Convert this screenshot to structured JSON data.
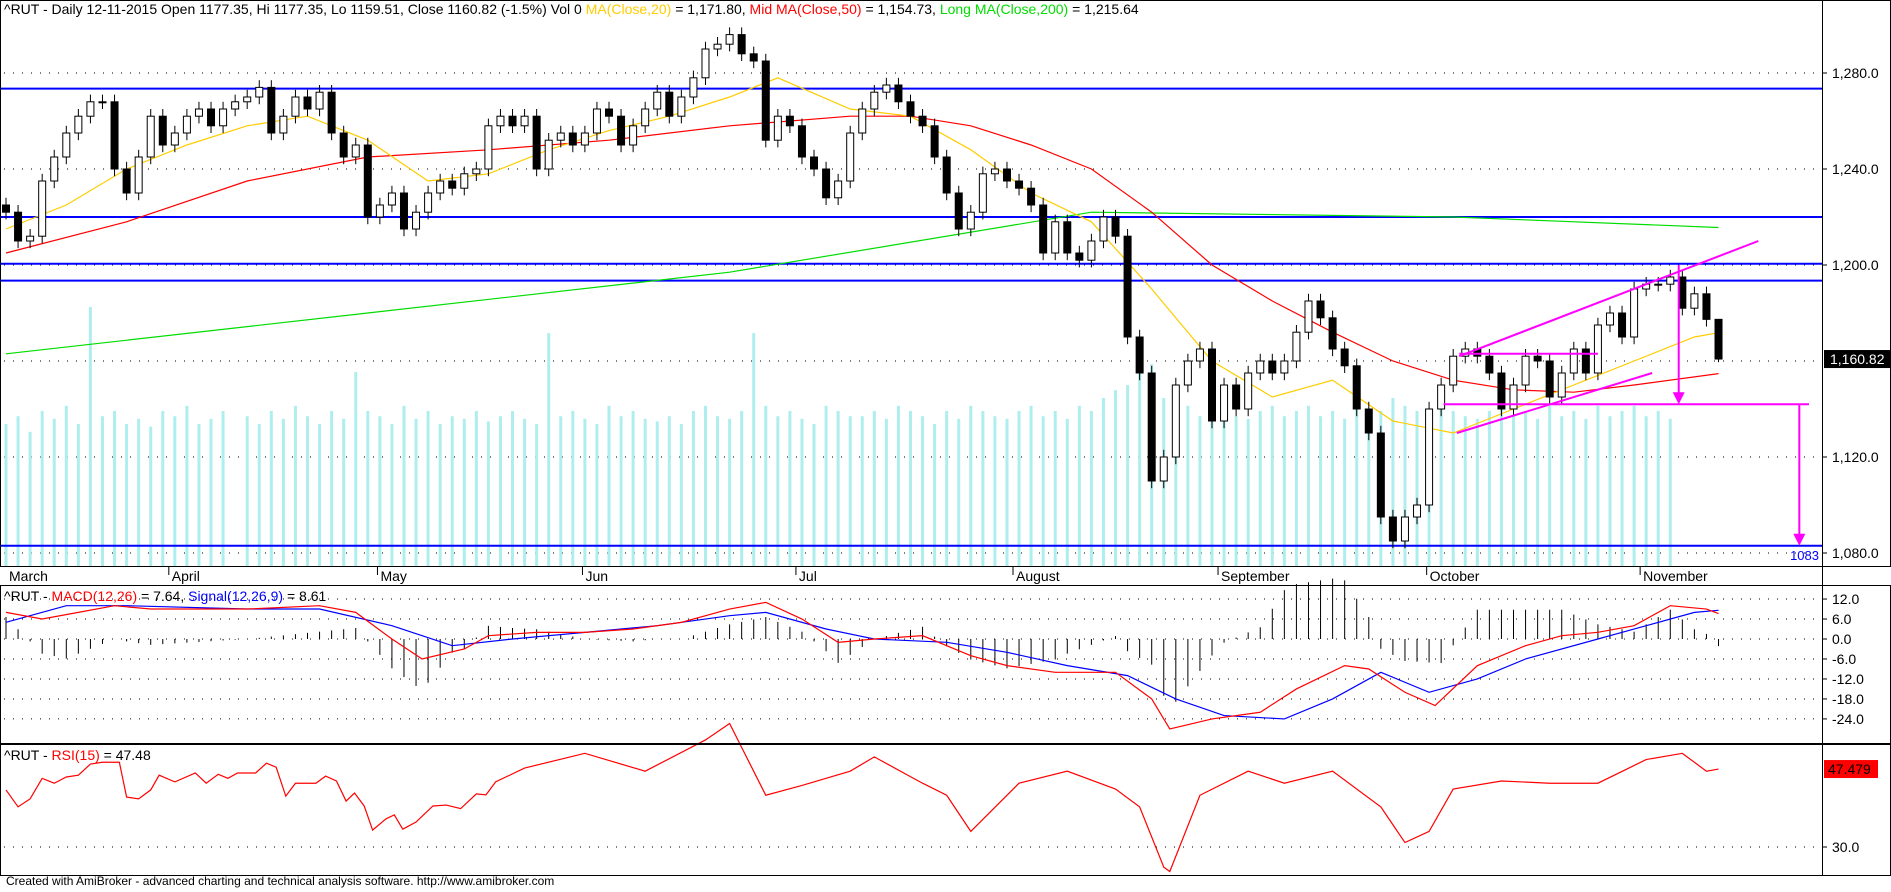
{
  "header": {
    "symbol_prefix": "^RUT - Daily 12-11-2015 Open 1177.35, Hi 1177.35, Lo 1159.51, Close 1160.82 (-1.5%) Vol 0 ",
    "ma20_label": "MA(Close,20)",
    "ma20_value": " = 1,171.80, ",
    "ma50_label": "Mid MA(Close,50)",
    "ma50_value": " = 1,154.73, ",
    "ma200_label": "Long MA(Close,200)",
    "ma200_value": " = 1,215.64"
  },
  "macd_header": {
    "prefix": "^RUT - ",
    "macd_label": "MACD(12,26)",
    "macd_value": " = 7.64, ",
    "signal_label": "Signal(12,26,9)",
    "signal_value": " = 8.61"
  },
  "rsi_header": {
    "prefix": "^RUT - ",
    "rsi_label": "RSI(15)",
    "rsi_value": " = 47.48"
  },
  "footer": "Created with AmiBroker - advanced charting and technical analysis software. http://www.amibroker.com",
  "colors": {
    "ma20": "#ffcc00",
    "ma50": "#ff0000",
    "ma200": "#00dd00",
    "macd": "#ff0000",
    "signal": "#0000ff",
    "rsi": "#ff0000",
    "level": "#0000ff",
    "annot": "#ff00ff",
    "volume": "#afeeee"
  },
  "chart_data": [
    {
      "type": "candlestick",
      "title": "^RUT - Daily",
      "ylim": [
        1075,
        1305
      ],
      "y_ticks": [
        "1,280.0",
        "1,240.0",
        "1,200.0",
        "1,120.0",
        "1,080.0"
      ],
      "y_tick_values": [
        1280,
        1240,
        1200,
        1120,
        1080
      ],
      "last_price_label": "1,160.82",
      "last_price": 1160.82,
      "months": [
        "March",
        "April",
        "May",
        "Jun",
        "Jul",
        "August",
        "September",
        "October",
        "November"
      ],
      "month_start_index": [
        0,
        13.5,
        30.8,
        47.8,
        65.5,
        83.5,
        100.5,
        117.8,
        135.5
      ],
      "close": [
        1222,
        1210,
        1212,
        1235,
        1245,
        1255,
        1262,
        1268,
        1268,
        1240,
        1230,
        1245,
        1262,
        1250,
        1255,
        1262,
        1265,
        1258,
        1265,
        1268,
        1270,
        1274,
        1255,
        1262,
        1270,
        1265,
        1272,
        1255,
        1245,
        1250,
        1220,
        1225,
        1230,
        1215,
        1222,
        1230,
        1235,
        1232,
        1238,
        1240,
        1258,
        1262,
        1258,
        1262,
        1240,
        1252,
        1255,
        1250,
        1255,
        1265,
        1262,
        1250,
        1258,
        1265,
        1272,
        1262,
        1270,
        1278,
        1290,
        1292,
        1296,
        1288,
        1285,
        1252,
        1262,
        1258,
        1245,
        1240,
        1228,
        1235,
        1255,
        1265,
        1272,
        1275,
        1268,
        1262,
        1258,
        1245,
        1230,
        1215,
        1222,
        1238,
        1240,
        1235,
        1232,
        1225,
        1205,
        1218,
        1205,
        1202,
        1210,
        1220,
        1212,
        1170,
        1155,
        1110,
        1120,
        1150,
        1160,
        1165,
        1135,
        1150,
        1140,
        1155,
        1160,
        1155,
        1160,
        1172,
        1185,
        1178,
        1165,
        1158,
        1140,
        1130,
        1095,
        1085,
        1095,
        1100,
        1140,
        1150,
        1162,
        1165,
        1162,
        1155,
        1140,
        1150,
        1162,
        1160,
        1145,
        1155,
        1165,
        1155,
        1175,
        1180,
        1170,
        1190,
        1192,
        1192,
        1195,
        1182,
        1188,
        1177.35,
        1160.82
      ],
      "first_open": 1225,
      "last_bar": {
        "open": 1177.35,
        "high": 1177.35,
        "low": 1159.51,
        "close": 1160.82
      },
      "volume": [
        55,
        58,
        52,
        60,
        57,
        62,
        55,
        100,
        58,
        60,
        55,
        57,
        54,
        60,
        58,
        62,
        55,
        57,
        60,
        0,
        58,
        55,
        60,
        57,
        62,
        58,
        55,
        60,
        57,
        75,
        60,
        58,
        55,
        62,
        57,
        60,
        55,
        58,
        57,
        60,
        56,
        58,
        60,
        57,
        55,
        90,
        58,
        60,
        57,
        55,
        62,
        58,
        60,
        57,
        56,
        58,
        55,
        60,
        62,
        58,
        57,
        60,
        90,
        62,
        58,
        60,
        57,
        55,
        62,
        60,
        58,
        58,
        60,
        57,
        62,
        60,
        58,
        55,
        60,
        57,
        62,
        60,
        58,
        57,
        60,
        62,
        58,
        60,
        57,
        62,
        60,
        65,
        68,
        70,
        85,
        78,
        65,
        60,
        62,
        58,
        60,
        62,
        58,
        57,
        60,
        62,
        58,
        60,
        62,
        58,
        60,
        57,
        62,
        58,
        60,
        65,
        62,
        60,
        58,
        62,
        60,
        58,
        57,
        60,
        62,
        58,
        60,
        57,
        62,
        58,
        60,
        57,
        62,
        58,
        60,
        62,
        58,
        60,
        57
      ],
      "ma20": [
        [
          0,
          1215
        ],
        [
          5,
          1225
        ],
        [
          10,
          1240
        ],
        [
          15,
          1250
        ],
        [
          20,
          1258
        ],
        [
          25,
          1262
        ],
        [
          30,
          1252
        ],
        [
          35,
          1235
        ],
        [
          40,
          1238
        ],
        [
          45,
          1248
        ],
        [
          50,
          1256
        ],
        [
          55,
          1262
        ],
        [
          60,
          1270
        ],
        [
          64,
          1278
        ],
        [
          70,
          1265
        ],
        [
          75,
          1262
        ],
        [
          80,
          1248
        ],
        [
          85,
          1230
        ],
        [
          90,
          1218
        ],
        [
          95,
          1190
        ],
        [
          100,
          1160
        ],
        [
          105,
          1145
        ],
        [
          110,
          1152
        ],
        [
          115,
          1135
        ],
        [
          120,
          1130
        ],
        [
          125,
          1140
        ],
        [
          130,
          1150
        ],
        [
          135,
          1160
        ],
        [
          140,
          1170
        ],
        [
          142,
          1171.8
        ]
      ],
      "ma50": [
        [
          0,
          1205
        ],
        [
          10,
          1218
        ],
        [
          20,
          1235
        ],
        [
          30,
          1245
        ],
        [
          40,
          1248
        ],
        [
          50,
          1252
        ],
        [
          60,
          1258
        ],
        [
          70,
          1262
        ],
        [
          75,
          1262
        ],
        [
          80,
          1258
        ],
        [
          85,
          1250
        ],
        [
          90,
          1240
        ],
        [
          95,
          1222
        ],
        [
          100,
          1200
        ],
        [
          105,
          1185
        ],
        [
          110,
          1172
        ],
        [
          115,
          1160
        ],
        [
          120,
          1152
        ],
        [
          125,
          1148
        ],
        [
          130,
          1147
        ],
        [
          135,
          1150
        ],
        [
          142,
          1154.73
        ]
      ],
      "ma200": [
        [
          0,
          1163
        ],
        [
          30,
          1180
        ],
        [
          60,
          1197
        ],
        [
          90,
          1222
        ],
        [
          120,
          1220
        ],
        [
          142,
          1215.64
        ]
      ],
      "levels": [
        1273.5,
        1220,
        1200.5,
        1193.5,
        1083
      ],
      "level_label": "1083",
      "annotations": {
        "upper_trend": [
          [
            120.5,
            1162
          ],
          [
            145.3,
            1210
          ]
        ],
        "lower_trend": [
          [
            120.3,
            1130
          ],
          [
            136.5,
            1155
          ]
        ],
        "range_top": [
          [
            120.5,
            1163
          ],
          [
            132,
            1163
          ]
        ],
        "target_line": [
          [
            119.2,
            1142
          ],
          [
            149.5,
            1142
          ]
        ],
        "arrow_1": [
          [
            138.7,
            1200
          ],
          [
            138.7,
            1142
          ]
        ],
        "arrow_2": [
          [
            148.7,
            1142
          ],
          [
            148.7,
            1083
          ]
        ]
      }
    },
    {
      "type": "line",
      "title": "MACD(12,26) / Signal(12,26,9)",
      "ylim": [
        -28,
        14
      ],
      "y_ticks": [
        "12.0",
        "6.0",
        "0.0",
        "-6.0",
        "-12.0",
        "-18.0",
        "-24.0"
      ],
      "y_tick_values": [
        12,
        6,
        0,
        -6,
        -12,
        -18,
        -24
      ],
      "macd": [
        [
          0,
          8
        ],
        [
          3,
          6
        ],
        [
          6,
          8
        ],
        [
          9,
          10
        ],
        [
          12,
          9
        ],
        [
          20,
          9
        ],
        [
          26,
          10
        ],
        [
          29,
          8
        ],
        [
          32,
          0
        ],
        [
          34.5,
          -6
        ],
        [
          38,
          -3
        ],
        [
          40,
          1
        ],
        [
          44,
          2
        ],
        [
          48,
          2
        ],
        [
          52,
          3
        ],
        [
          56,
          5
        ],
        [
          60,
          9
        ],
        [
          63,
          11
        ],
        [
          66,
          6
        ],
        [
          69,
          -1
        ],
        [
          72,
          0
        ],
        [
          76,
          1
        ],
        [
          80,
          -5
        ],
        [
          83,
          -8
        ],
        [
          87,
          -10
        ],
        [
          92,
          -10
        ],
        [
          95,
          -18
        ],
        [
          96.5,
          -27
        ],
        [
          100,
          -24
        ],
        [
          104,
          -22
        ],
        [
          107,
          -15
        ],
        [
          111,
          -8
        ],
        [
          113,
          -9
        ],
        [
          116,
          -16
        ],
        [
          118.5,
          -20
        ],
        [
          122,
          -8
        ],
        [
          126,
          -2
        ],
        [
          129,
          1
        ],
        [
          132,
          2
        ],
        [
          135,
          4
        ],
        [
          138,
          10
        ],
        [
          141,
          9
        ],
        [
          142,
          7.64
        ]
      ],
      "signal": [
        [
          0,
          5
        ],
        [
          5,
          10
        ],
        [
          10,
          10
        ],
        [
          20,
          9
        ],
        [
          26,
          9
        ],
        [
          32,
          4
        ],
        [
          37,
          -2
        ],
        [
          42,
          0
        ],
        [
          48,
          2
        ],
        [
          54,
          4
        ],
        [
          60,
          7
        ],
        [
          63,
          8
        ],
        [
          68,
          3
        ],
        [
          72,
          0
        ],
        [
          78,
          -1
        ],
        [
          83,
          -4
        ],
        [
          88,
          -8
        ],
        [
          93,
          -11
        ],
        [
          97,
          -18
        ],
        [
          101,
          -23
        ],
        [
          106,
          -24
        ],
        [
          110,
          -18
        ],
        [
          114,
          -10
        ],
        [
          118,
          -16
        ],
        [
          122,
          -12
        ],
        [
          126,
          -6
        ],
        [
          132,
          0
        ],
        [
          136,
          4
        ],
        [
          140,
          8
        ],
        [
          142,
          8.61
        ]
      ]
    },
    {
      "type": "line",
      "title": "RSI(15)",
      "ylim": [
        25,
        72
      ],
      "y_ticks": [
        "30.0"
      ],
      "y_tick_values": [
        30
      ],
      "last_label": "47.479",
      "rsi": [
        [
          0,
          42.8
        ],
        [
          1,
          39
        ],
        [
          2,
          40.8
        ],
        [
          3,
          45.4
        ],
        [
          4,
          44.3
        ],
        [
          5,
          45.7
        ],
        [
          6,
          46.1
        ],
        [
          7,
          48.6
        ],
        [
          8,
          49
        ],
        [
          9.4,
          49
        ],
        [
          10,
          41.2
        ],
        [
          11,
          40.8
        ],
        [
          12,
          42.8
        ],
        [
          12.7,
          46.1
        ],
        [
          14,
          44.6
        ],
        [
          15.7,
          46.6
        ],
        [
          16.6,
          44.3
        ],
        [
          17.6,
          46.3
        ],
        [
          18.4,
          45.4
        ],
        [
          19.2,
          46.6
        ],
        [
          20.7,
          46.6
        ],
        [
          21.6,
          48.8
        ],
        [
          22.4,
          47.9
        ],
        [
          23.2,
          41.4
        ],
        [
          24,
          44.3
        ],
        [
          25.7,
          44.3
        ],
        [
          26.5,
          45.9
        ],
        [
          27.4,
          44.8
        ],
        [
          28.2,
          40.3
        ],
        [
          28.9,
          42.1
        ],
        [
          29.7,
          39.2
        ],
        [
          30.4,
          33.8
        ],
        [
          31.5,
          36.3
        ],
        [
          32.2,
          37.2
        ],
        [
          32.9,
          34
        ],
        [
          34,
          35.6
        ],
        [
          35.4,
          39.2
        ],
        [
          36.5,
          39.4
        ],
        [
          37.7,
          38.6
        ],
        [
          39,
          41.9
        ],
        [
          39.8,
          41.7
        ],
        [
          40.6,
          44.6
        ],
        [
          43,
          47.7
        ],
        [
          48,
          51
        ],
        [
          53,
          47
        ],
        [
          58,
          54
        ],
        [
          60,
          57.7
        ],
        [
          63,
          41.6
        ],
        [
          66,
          43.8
        ],
        [
          70,
          47
        ],
        [
          72,
          50.2
        ],
        [
          76,
          44.3
        ],
        [
          78,
          41.6
        ],
        [
          80,
          33.5
        ],
        [
          84,
          44.3
        ],
        [
          88,
          47
        ],
        [
          92,
          43
        ],
        [
          94,
          39
        ],
        [
          96,
          25.5
        ],
        [
          96.5,
          24.5
        ],
        [
          99,
          41.6
        ],
        [
          103,
          47
        ],
        [
          106,
          44.3
        ],
        [
          110,
          47
        ],
        [
          114,
          39
        ],
        [
          116,
          31
        ],
        [
          118,
          33.5
        ],
        [
          120,
          43
        ],
        [
          124,
          44.8
        ],
        [
          128,
          44.3
        ],
        [
          132,
          44.3
        ],
        [
          136,
          49.6
        ],
        [
          139,
          51
        ],
        [
          141,
          47
        ],
        [
          142,
          47.48
        ]
      ]
    }
  ]
}
